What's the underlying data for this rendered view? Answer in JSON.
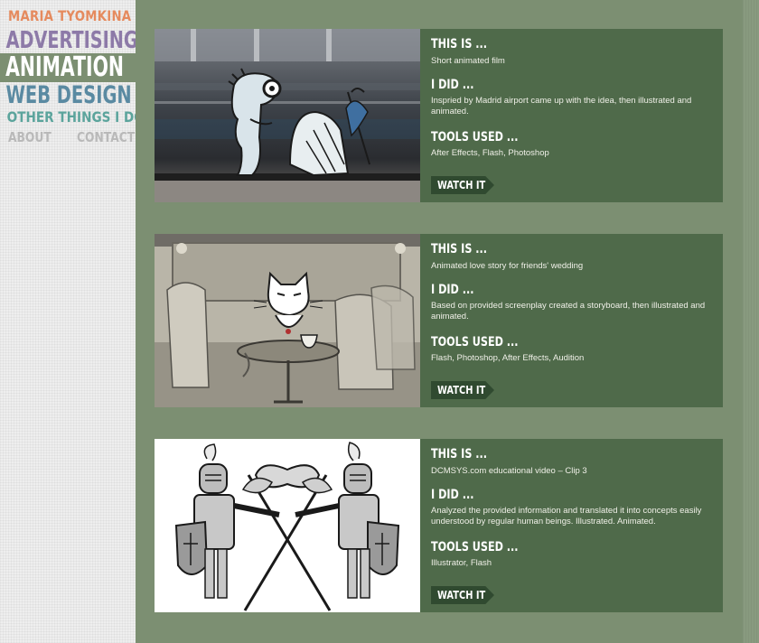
{
  "brand": "MARIA TYOMKINA",
  "nav": {
    "advertising": "ADVERTISING",
    "animation": "ANIMATION",
    "web_design": "WEB DESIGN",
    "other": "OTHER THINGS I DO",
    "about": "ABOUT",
    "contact": "CONTACT"
  },
  "projects": [
    {
      "this_is_label": "THIS IS ...",
      "this_is": "Short animated film",
      "i_did_label": "I DID ...",
      "i_did": "Inspried by Madrid airport came up with the idea, then illustrated and animated.",
      "tools_label": "TOOLS USED ...",
      "tools": "After Effects, Flash, Photoshop",
      "watch_label": "WATCH IT"
    },
    {
      "this_is_label": "THIS IS ...",
      "this_is": "Animated love story for friends' wedding",
      "i_did_label": "I DID ...",
      "i_did": "Based on provided screenplay created a storyboard, then illustrated and animated.",
      "tools_label": "TOOLS USED ...",
      "tools": "Flash, Photoshop, After Effects, Audition",
      "watch_label": "WATCH IT"
    },
    {
      "this_is_label": "THIS IS ...",
      "this_is": "DCMSYS.com educational video – Clip 3",
      "i_did_label": "I DID ...",
      "i_did": "Analyzed the provided information and translated it into concepts easily understood by regular human beings. Illustrated. Animated.",
      "tools_label": "TOOLS USED ...",
      "tools": "Illustrator, Flash",
      "watch_label": "WATCH IT"
    }
  ]
}
